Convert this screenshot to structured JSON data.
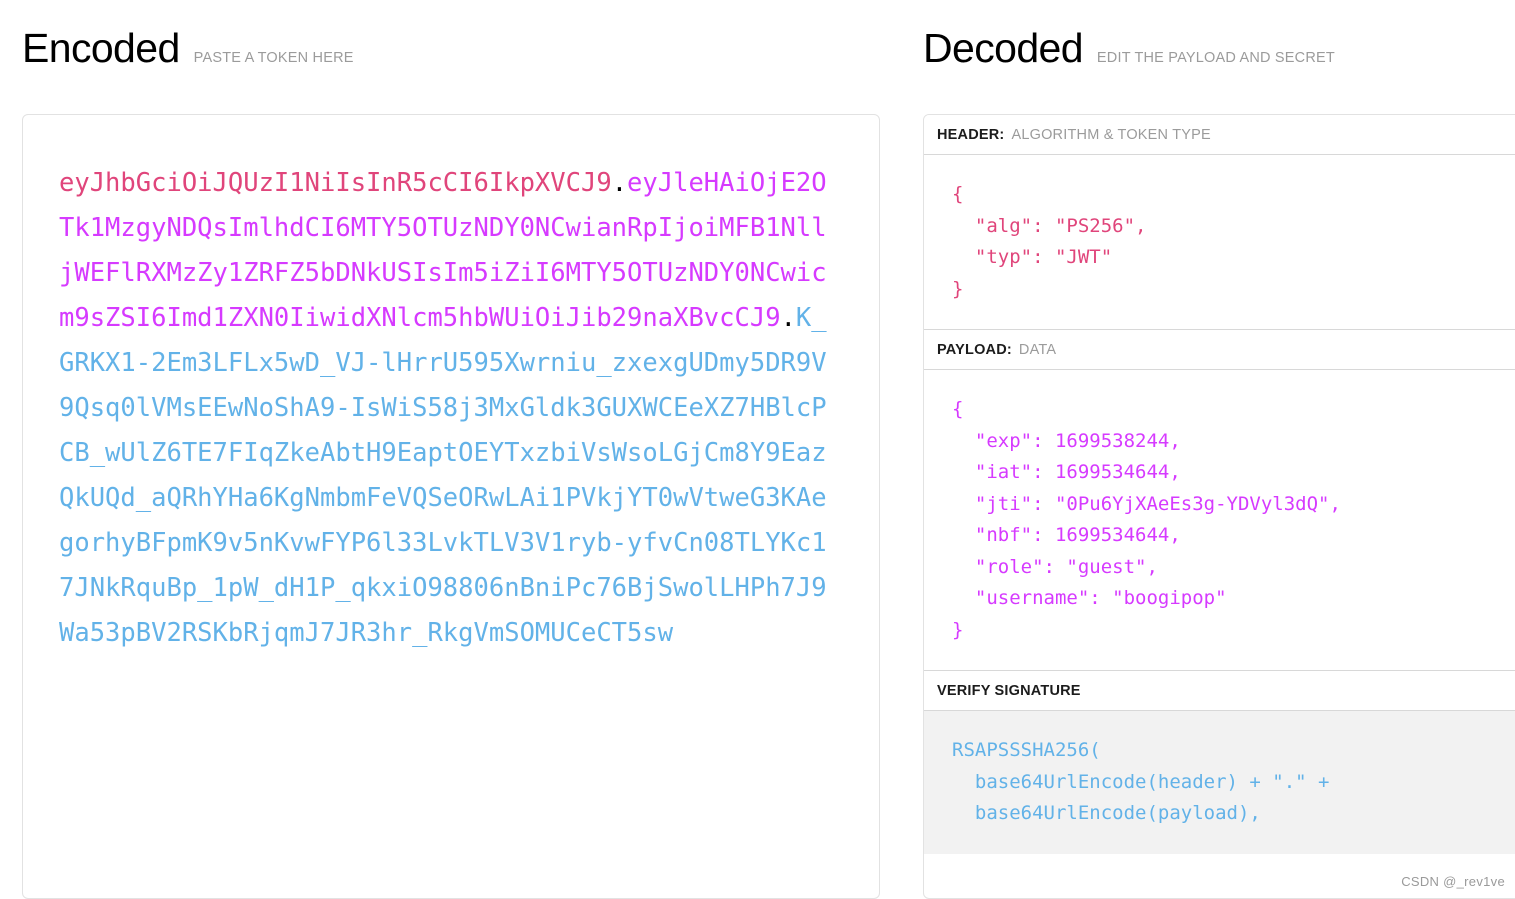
{
  "encoded": {
    "title": "Encoded",
    "subtitle": "PASTE A TOKEN HERE",
    "token_header": "eyJhbGciOiJQUzI1NiIsInR5cCI6IkpXVCJ9",
    "token_payload": "eyJleHAiOjE2OTk1MzgyNDQsImlhdCI6MTY5OTUzNDY0NCwianRpIjoiMFB1NlljWEFlRXMzZy1ZRFZ5bDNkUSIsIm5iZiI6MTY5OTUzNDY0NCwicm9sZSI6Imd1ZXN0IiwidXNlcm5hbWUiOiJib29naXBvcCJ9",
    "token_signature": "K_GRKX1-2Em3LFLx5wD_VJ-lHrrU595Xwrniu_zxexgUDmy5DR9V9Qsq0lVMsEEwNoShA9-IsWiS58j3MxGldk3GUXWCEeXZ7HBlcPCB_wUlZ6TE7FIqZkeAbtH9EaptOEYTxzbiVsWsoLGjCm8Y9EazQkUQd_aQRhYHa6KgNmbmFeVQSeORwLAi1PVkjYT0wVtweG3KAegorhyBFpmK9v5nKvwFYP6l33LvkTLV3V1ryb-yfvCn08TLYKc17JNkRquBp_1pW_dH1P_qkxiO98806nBniPc76BjSwolLHPh7J9Wa53pBV2RSKbRjqmJ7JR3hr_RkgVmSOMUCeCT5sw",
    "separator": ".",
    "colors": {
      "header": "#e0457b",
      "payload": "#d63aff",
      "signature": "#62b2e8"
    }
  },
  "decoded": {
    "title": "Decoded",
    "subtitle": "EDIT THE PAYLOAD AND SECRET",
    "sections": {
      "header": {
        "label": "HEADER:",
        "sublabel": "ALGORITHM & TOKEN TYPE",
        "code": "{\n  \"alg\": \"PS256\",\n  \"typ\": \"JWT\"\n}"
      },
      "payload": {
        "label": "PAYLOAD:",
        "sublabel": "DATA",
        "code": "{\n  \"exp\": 1699538244,\n  \"iat\": 1699534644,\n  \"jti\": \"0Pu6YjXAeEs3g-YDVyl3dQ\",\n  \"nbf\": 1699534644,\n  \"role\": \"guest\",\n  \"username\": \"boogipop\"\n}"
      },
      "signature": {
        "label": "VERIFY SIGNATURE",
        "sublabel": "",
        "code": "RSAPSSSHA256(\n  base64UrlEncode(header) + \".\" +\n  base64UrlEncode(payload),"
      }
    }
  },
  "watermark": "CSDN @_rev1ve"
}
